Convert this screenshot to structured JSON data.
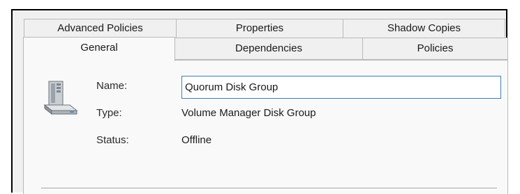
{
  "tabs_row1": [
    {
      "label": "Advanced Policies"
    },
    {
      "label": "Properties"
    },
    {
      "label": "Shadow Copies"
    }
  ],
  "tabs_row2": [
    {
      "label": "General",
      "selected": true
    },
    {
      "label": "Dependencies"
    },
    {
      "label": "Policies"
    }
  ],
  "general": {
    "icon": "disk-group-icon",
    "name_label": "Name:",
    "name_value": "Quorum Disk Group",
    "type_label": "Type:",
    "type_value": "Volume Manager Disk Group",
    "status_label": "Status:",
    "status_value": "Offline"
  },
  "colors": {
    "dialog_bg": "#f0f0f0",
    "panel_bg": "#f9f9f9",
    "input_border": "#3c7fb1"
  }
}
